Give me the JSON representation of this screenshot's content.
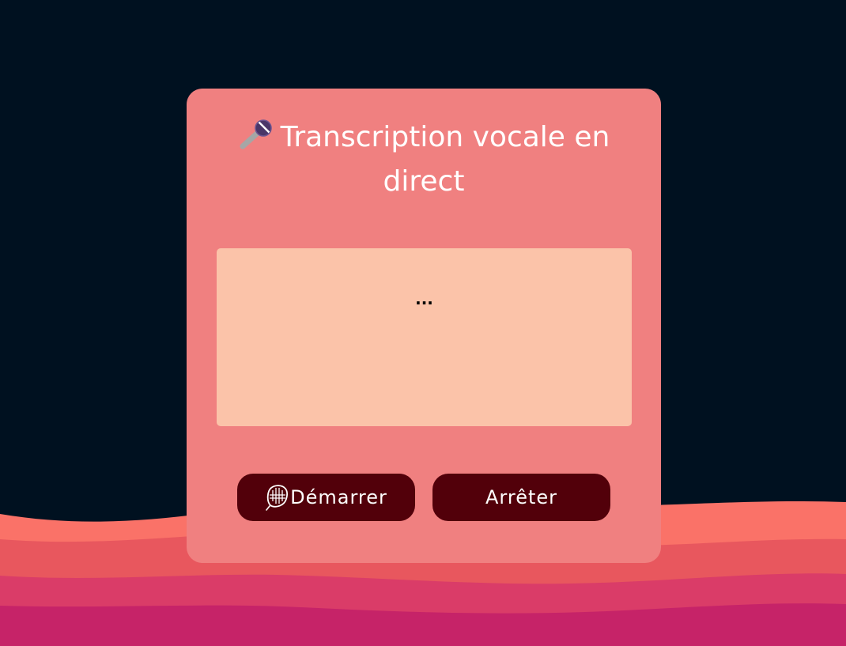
{
  "card": {
    "title": "Transcription vocale en direct",
    "title_icon": "microphone-emoji"
  },
  "transcript": {
    "text": "..."
  },
  "buttons": {
    "start_label": "Démarrer",
    "start_icon": "microphone-outline-icon",
    "stop_label": "Arrêter"
  },
  "colors": {
    "background": "#001120",
    "card": "#f08080",
    "transcript_box": "#fbc3a9",
    "button": "#52000a",
    "wave_1": "#fa7268",
    "wave_2": "#e8575e",
    "wave_3": "#da3c68",
    "wave_4": "#c62368"
  }
}
